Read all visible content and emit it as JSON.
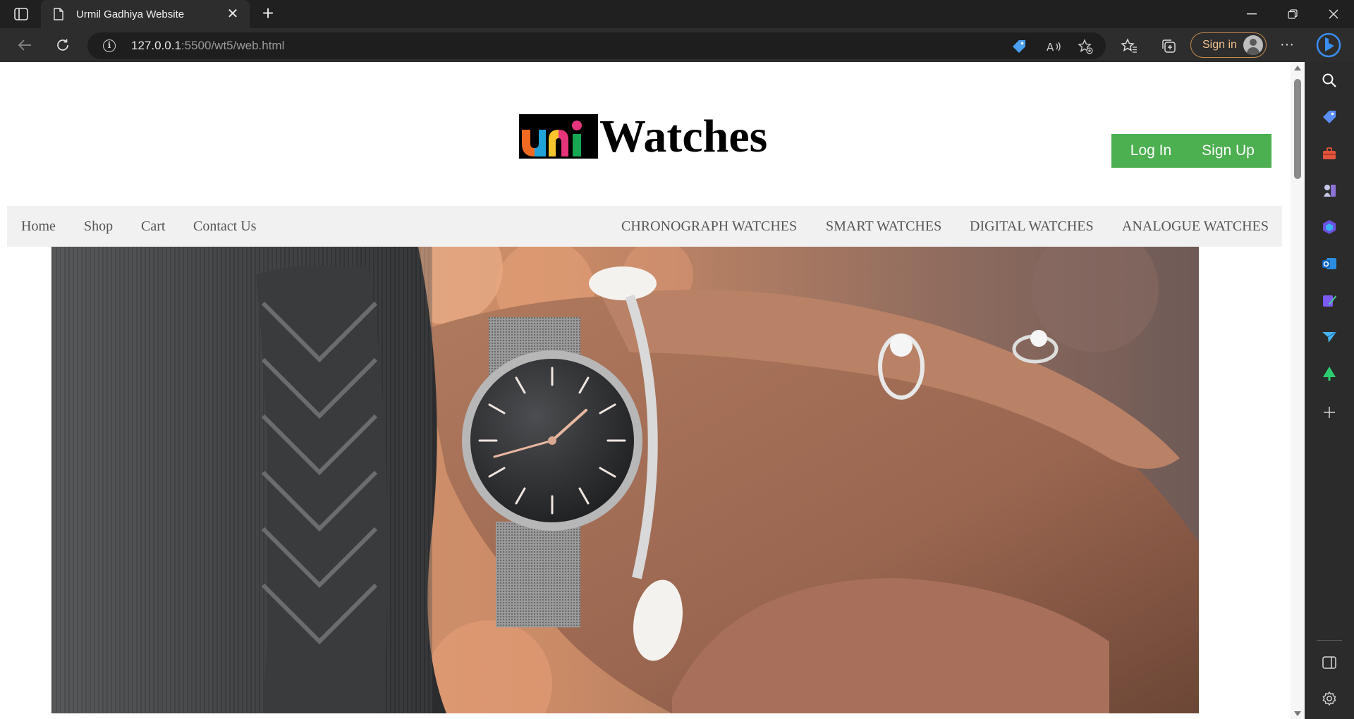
{
  "browser": {
    "tab_title": "Urmil Gadhiya Website",
    "url_host": "127.0.0.1",
    "url_rest": ":5500/wt5/web.html",
    "signin_label": "Sign in",
    "window_controls": [
      "minimize-icon",
      "restore-icon",
      "close-icon"
    ],
    "toolbar_icons": [
      "tag-icon",
      "read-aloud-icon",
      "add-favorite-icon",
      "favorites-icon",
      "collections-icon",
      "more-icon",
      "copilot-icon"
    ],
    "sidebar_icons": [
      "search-icon",
      "shopping-icon",
      "tools-icon",
      "games-icon",
      "office-icon",
      "outlook-icon",
      "designer-icon",
      "send-icon",
      "tree-icon",
      "add-icon",
      "sidebar-toggle-icon",
      "settings-icon"
    ]
  },
  "site": {
    "logo_text": "Watches",
    "logo_badge": "uni",
    "auth": {
      "login_label": "Log In",
      "signup_label": "Sign Up",
      "color": "#4caf50"
    },
    "nav_left": [
      "Home",
      "Shop",
      "Cart",
      "Contact Us"
    ],
    "nav_right": [
      "CHRONOGRAPH WATCHES",
      "SMART WATCHES",
      "DIGITAL WATCHES",
      "ANALOGUE WATCHES"
    ],
    "navbar_color": "#f1f1f1"
  }
}
